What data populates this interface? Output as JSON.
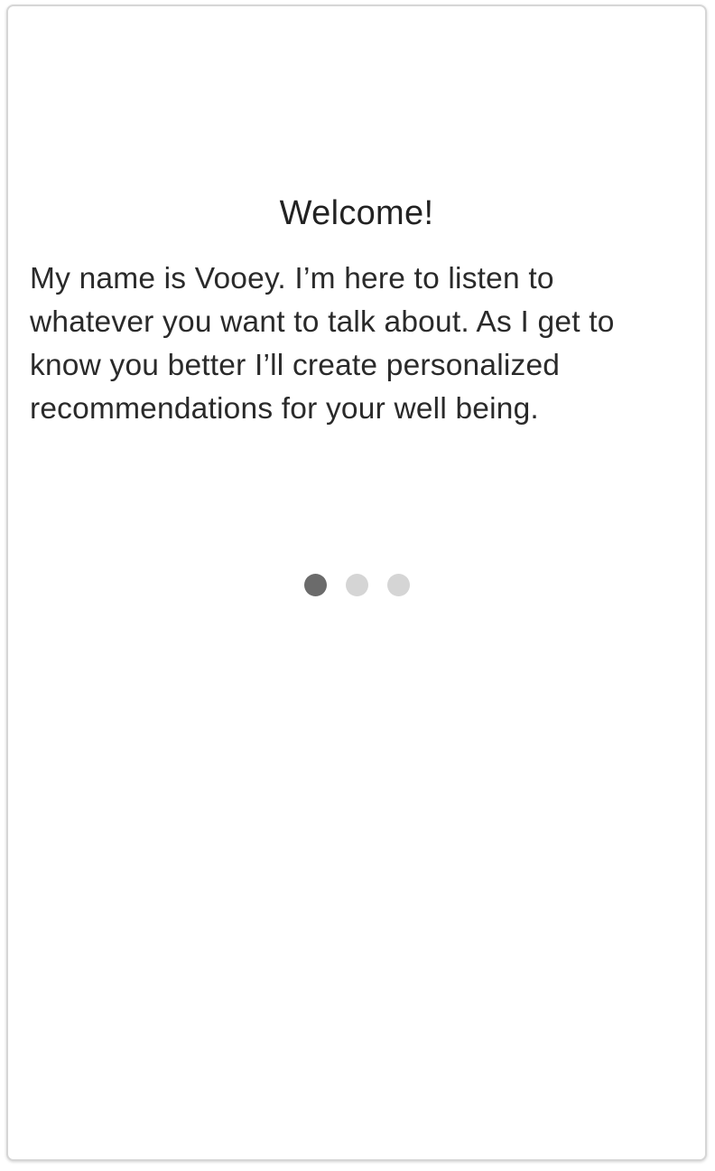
{
  "onboarding": {
    "title": "Welcome!",
    "body": "My name is Vooey. I’m here to listen to whatever you want to talk about. As I get to know you better I’ll create personalized recommendations for your well being.",
    "pager": {
      "total_pages": 3,
      "current_page": 1,
      "active_color": "#6b6b6b",
      "inactive_color": "#d5d5d5"
    }
  }
}
